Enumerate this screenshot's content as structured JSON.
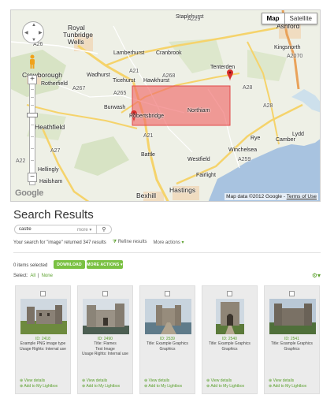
{
  "map": {
    "type_buttons": {
      "map": "Map",
      "satellite": "Satellite"
    },
    "google_logo": "Google",
    "attribution": "Map data ©2012 Google",
    "terms": "Terms of Use",
    "places": [
      {
        "name": "Royal",
        "size": "big"
      },
      {
        "name": "Tunbridge",
        "size": "big"
      },
      {
        "name": "Wells",
        "size": "big"
      },
      {
        "name": "Crowborough",
        "size": "big"
      },
      {
        "name": "Rotherfield",
        "size": "small"
      },
      {
        "name": "Heathfield",
        "size": "big"
      },
      {
        "name": "Hellingly",
        "size": "small"
      },
      {
        "name": "Hailsham",
        "size": "small"
      },
      {
        "name": "Staplehurst",
        "size": "small"
      },
      {
        "name": "Cranbrook",
        "size": "small"
      },
      {
        "name": "Lamberhurst",
        "size": "small"
      },
      {
        "name": "Wadhurst",
        "size": "small"
      },
      {
        "name": "Ticehurst",
        "size": "small"
      },
      {
        "name": "Hawkhurst",
        "size": "small"
      },
      {
        "name": "Burwash",
        "size": "small"
      },
      {
        "name": "Robertsbridge",
        "size": "small"
      },
      {
        "name": "Northiam",
        "size": "small"
      },
      {
        "name": "Tenterden",
        "size": "small"
      },
      {
        "name": "Ashford",
        "size": "big"
      },
      {
        "name": "Kingsnorth",
        "size": "small"
      },
      {
        "name": "Battle",
        "size": "small"
      },
      {
        "name": "Westfield",
        "size": "small"
      },
      {
        "name": "Rye",
        "size": "small"
      },
      {
        "name": "Winchelsea",
        "size": "small"
      },
      {
        "name": "Lydd",
        "size": "small"
      },
      {
        "name": "Fairlight",
        "size": "small"
      },
      {
        "name": "Hastings",
        "size": "big"
      },
      {
        "name": "Bexhill",
        "size": "big"
      },
      {
        "name": "Camber",
        "size": "small"
      }
    ],
    "roads": [
      "A21",
      "A229",
      "A28",
      "A268",
      "A265",
      "A22",
      "A259",
      "A2070",
      "A267",
      "A27",
      "A26",
      "A21",
      "A28"
    ]
  },
  "results": {
    "title": "Search Results",
    "search_value": "castle",
    "more_label": "more",
    "summary": "Your search for \"image\" returned 347 results",
    "refine": "Refine results",
    "more_actions": "More actions",
    "items_selected": "0 items selected",
    "download": "DOWNLOAD",
    "more_actions_btn": "MORE ACTIONS",
    "select_label": "Select:",
    "select_all": "All",
    "select_sep": "|",
    "select_none": "None"
  },
  "cards": [
    {
      "id": "ID: 2418",
      "title_lines": [
        "Example PNG image type",
        "Usage Rights: Internal use"
      ],
      "view": "View details",
      "add": "Add to My Lightbox"
    },
    {
      "id": "ID: 2490",
      "title_lines": [
        "Title: Flames",
        "Test Image",
        "Usage Rights: Internal use"
      ],
      "view": "View details",
      "add": "Add to My Lightbox"
    },
    {
      "id": "ID: 2539",
      "title_lines": [
        "Title: Example Graphics",
        "Graphics"
      ],
      "view": "View details",
      "add": "Add to My Lightbox"
    },
    {
      "id": "ID: 2540",
      "title_lines": [
        "Title: Example Graphics",
        "Graphics"
      ],
      "view": "View details",
      "add": "Add to My Lightbox"
    },
    {
      "id": "ID: 2541",
      "title_lines": [
        "Title: Example Graphics",
        "Graphics"
      ],
      "view": "View details",
      "add": "Add to My Lightbox"
    }
  ],
  "colors": {
    "accent": "#7ac142",
    "link": "#5aa02c",
    "selection": "#f06a6a"
  }
}
